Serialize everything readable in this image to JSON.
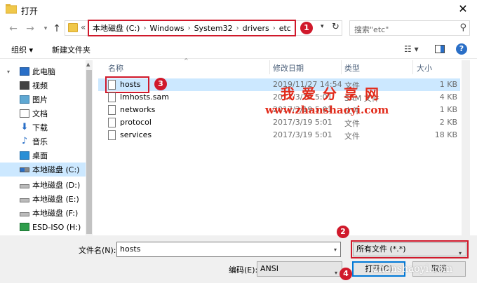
{
  "window": {
    "title": "打开"
  },
  "address": {
    "crumbs": [
      "本地磁盘 (C:)",
      "Windows",
      "System32",
      "drivers",
      "etc"
    ],
    "overflow": "«"
  },
  "search": {
    "placeholder": "搜索\"etc\""
  },
  "toolbar": {
    "organize": "组织",
    "new_folder": "新建文件夹"
  },
  "sidebar": {
    "items": [
      {
        "label": "此电脑",
        "icon": "computer-icon"
      },
      {
        "label": "视频",
        "icon": "video-icon"
      },
      {
        "label": "图片",
        "icon": "pictures-icon"
      },
      {
        "label": "文档",
        "icon": "documents-icon"
      },
      {
        "label": "下载",
        "icon": "download-icon"
      },
      {
        "label": "音乐",
        "icon": "music-icon"
      },
      {
        "label": "桌面",
        "icon": "desktop-icon"
      },
      {
        "label": "本地磁盘 (C:)",
        "icon": "drive-icon"
      },
      {
        "label": "本地磁盘 (D:)",
        "icon": "drive-icon"
      },
      {
        "label": "本地磁盘 (E:)",
        "icon": "drive-icon"
      },
      {
        "label": "本地磁盘 (F:)",
        "icon": "drive-icon"
      },
      {
        "label": "ESD-ISO (H:)",
        "icon": "disc-icon"
      }
    ]
  },
  "columns": {
    "name": "名称",
    "modified": "修改日期",
    "type": "类型",
    "size": "大小"
  },
  "files": [
    {
      "name": "hosts",
      "date": "2019/11/27 14:54",
      "type": "文件",
      "size": "1 KB"
    },
    {
      "name": "lmhosts.sam",
      "date": "2017/3/19 5:01",
      "type": "SAM 文件",
      "size": "4 KB"
    },
    {
      "name": "networks",
      "date": "2017/3/19 5:01",
      "type": "文件",
      "size": "1 KB"
    },
    {
      "name": "protocol",
      "date": "2017/3/19 5:01",
      "type": "文件",
      "size": "2 KB"
    },
    {
      "name": "services",
      "date": "2017/3/19 5:01",
      "type": "文件",
      "size": "18 KB"
    }
  ],
  "bottom": {
    "filename_label": "文件名(N):",
    "filename_value": "hosts",
    "filetype_value": "所有文件 (*.*)",
    "encoding_label": "编码(E):",
    "encoding_value": "ANSI",
    "open_button": "打开(O)",
    "cancel_button": "取消"
  },
  "annotations": {
    "badge1": "1",
    "badge2": "2",
    "badge3": "3",
    "badge4": "4"
  },
  "watermark": {
    "cn": "我爱分享网",
    "url": "www.zhanshaoyi.com",
    "url2": "zhanshaoyi.com"
  },
  "colors": {
    "highlight": "#d0192b",
    "selection": "#cce8ff",
    "accent": "#0078d7"
  }
}
